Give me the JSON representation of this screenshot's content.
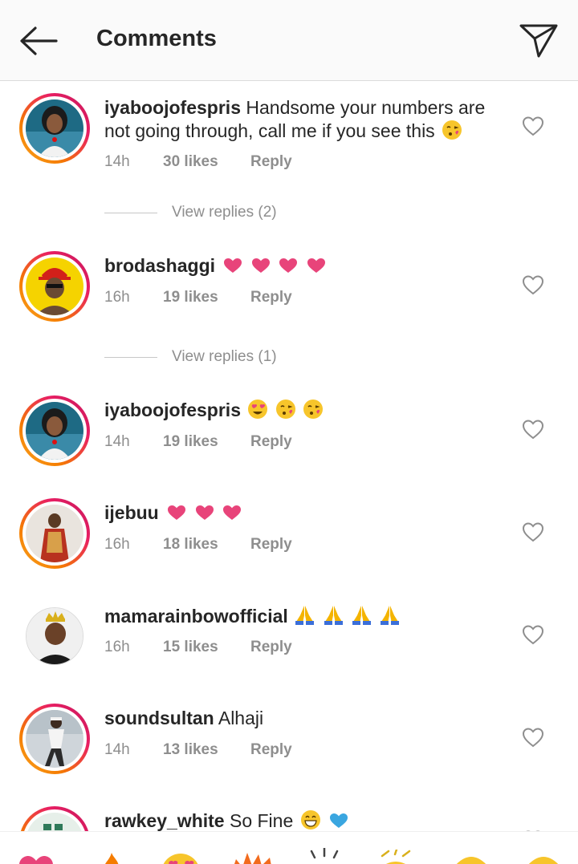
{
  "header": {
    "title": "Comments",
    "back_icon": "back-arrow-icon",
    "send_icon": "paper-plane-icon"
  },
  "comments": [
    {
      "username": "iyaboojofespris",
      "text": "Handsome your numbers are not going through, call me if you see this",
      "emojis": [
        "kiss-face"
      ],
      "time": "14h",
      "likes": "30 likes",
      "reply": "Reply",
      "view_replies": "View replies (2)",
      "avatar_ring": true
    },
    {
      "username": "brodashaggi",
      "text": "",
      "emojis": [
        "pink-heart",
        "pink-heart",
        "pink-heart",
        "pink-heart"
      ],
      "time": "16h",
      "likes": "19 likes",
      "reply": "Reply",
      "view_replies": "View replies (1)",
      "avatar_ring": true
    },
    {
      "username": "iyaboojofespris",
      "text": "",
      "emojis": [
        "heart-eyes-face",
        "kiss-face",
        "kiss-face"
      ],
      "time": "14h",
      "likes": "19 likes",
      "reply": "Reply",
      "avatar_ring": true
    },
    {
      "username": "ijebuu",
      "text": "",
      "emojis": [
        "pink-heart",
        "pink-heart",
        "pink-heart"
      ],
      "time": "16h",
      "likes": "18 likes",
      "reply": "Reply",
      "avatar_ring": true
    },
    {
      "username": "mamarainbowofficial",
      "text": "",
      "emojis": [
        "praying-hands",
        "praying-hands",
        "praying-hands",
        "praying-hands"
      ],
      "time": "16h",
      "likes": "15 likes",
      "reply": "Reply",
      "avatar_ring": false
    },
    {
      "username": "soundsultan",
      "text": "Alhaji",
      "emojis": [],
      "time": "14h",
      "likes": "13 likes",
      "reply": "Reply",
      "avatar_ring": true
    },
    {
      "username": "rawkey_white",
      "text": "So Fine",
      "emojis": [
        "grinning-face",
        "blue-heart"
      ],
      "avatar_ring": true
    }
  ],
  "emoji_bar": [
    "heart",
    "fire",
    "heart-eyes",
    "clap-burst",
    "sparkle",
    "raised-hands",
    "face",
    "face"
  ],
  "colors": {
    "accent_pink": "#e8447a",
    "meta_gray": "#8e8e8e",
    "ring_start": "#f9a825",
    "ring_end": "#c2185b"
  }
}
